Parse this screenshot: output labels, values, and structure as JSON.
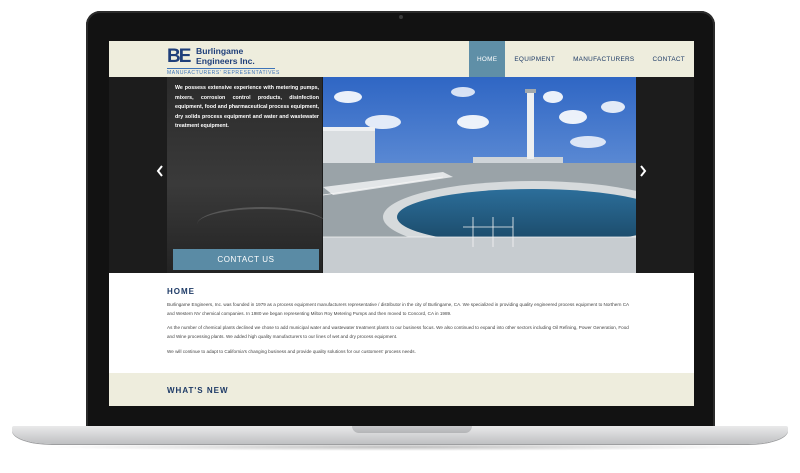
{
  "logo": {
    "mark": "BE",
    "name_line1": "Burlingame",
    "name_line2": "Engineers Inc.",
    "tagline": "MANUFACTURERS' REPRESENTATIVES"
  },
  "nav": {
    "items": [
      {
        "label": "HOME",
        "active": true
      },
      {
        "label": "EQUIPMENT",
        "active": false
      },
      {
        "label": "MANUFACTURERS",
        "active": false
      },
      {
        "label": "CONTACT",
        "active": false
      }
    ]
  },
  "hero": {
    "text": "We possess extensive experience with metering pumps, mixers, corrosion control products, disinfection equipment, food and pharmaceutical process equipment, dry solids process equipment and water and wastewater treatment equipment.",
    "cta_label": "CONTACT US",
    "prev_icon": "chevron-left-icon",
    "next_icon": "chevron-right-icon"
  },
  "home": {
    "title": "HOME",
    "paragraphs": [
      "Burlingame Engineers, Inc. was founded in 1979 as a process equipment manufacturers representative / distributor in the city of Burlingame, CA. We specialized in providing quality engineered process equipment to Northern CA and Western NV chemical companies. In 1980 we began representing Milton Roy Metering Pumps and then moved to Concord, CA in 1989.",
      "As the number of chemical plants declined we chose to add municipal water and wastewater treatment plants to our business focus. We also continued to expand into other sectors including Oil Refining, Power Generation, Food and Wine processing plants. We added high quality manufacturers to our lines of wet and dry process equipment.",
      "We will continue to adapt to California's changing business and provide quality solutions for our customers' process needs."
    ]
  },
  "whats_new": {
    "title": "WHAT'S NEW"
  },
  "colors": {
    "header_bg": "#eeeddd",
    "nav_active": "#5f8fa7",
    "brand_navy": "#1d3a66",
    "cta": "#5a8ba5"
  }
}
